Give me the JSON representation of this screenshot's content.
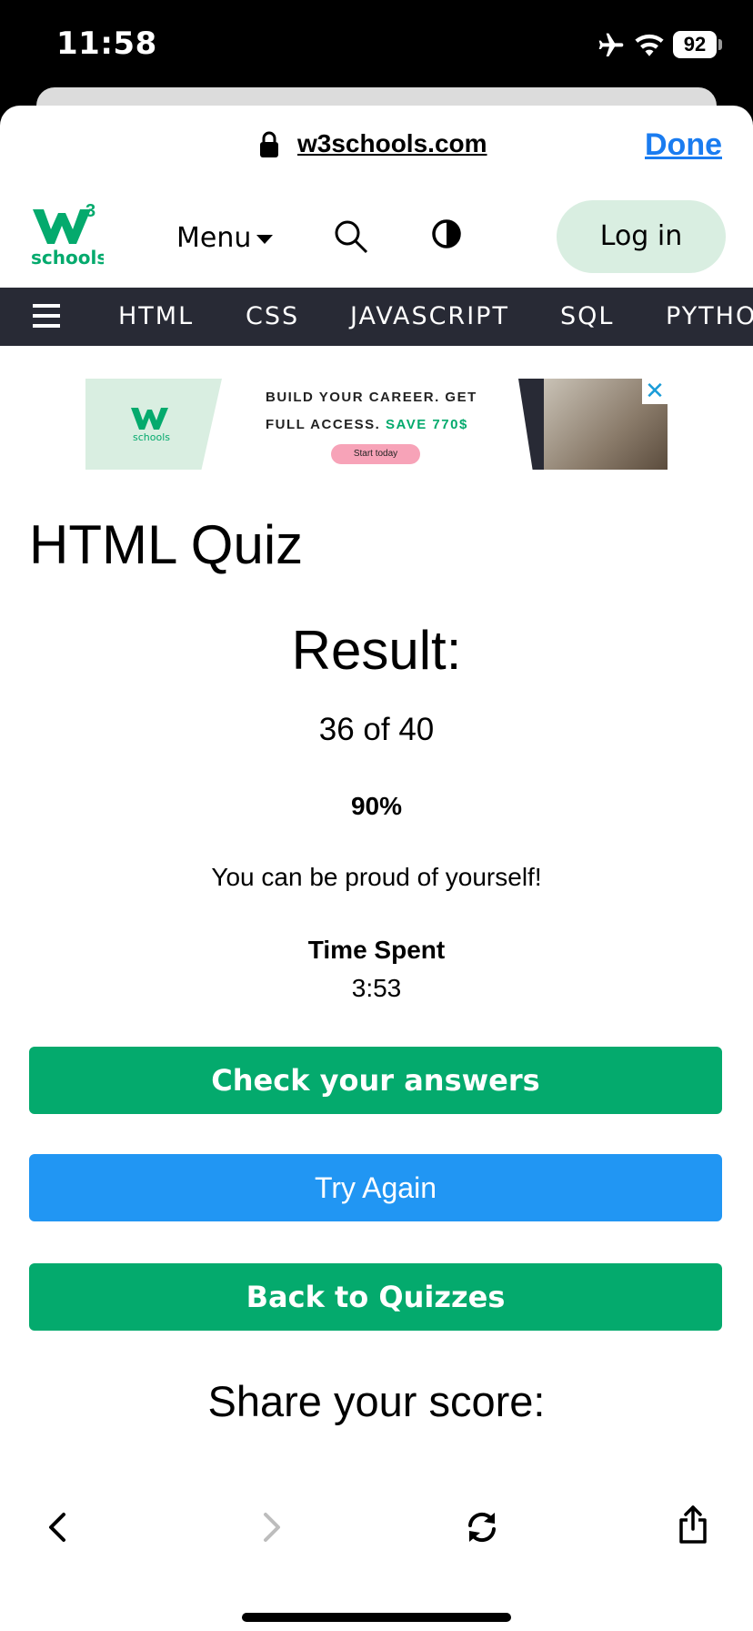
{
  "status_bar": {
    "time": "11:58",
    "battery": "92"
  },
  "browser": {
    "url": "w3schools.com",
    "done_label": "Done"
  },
  "topnav": {
    "logo_text": "schools",
    "logo_sup": "3",
    "menu_label": "Menu",
    "login_label": "Log in"
  },
  "subnav": {
    "items": [
      "HTML",
      "CSS",
      "JAVASCRIPT",
      "SQL",
      "PYTHO"
    ]
  },
  "ad": {
    "line1": "BUILD YOUR CAREER. GET",
    "line2_prefix": "FULL ACCESS.",
    "line2_save": "SAVE 770$",
    "button": "Start today",
    "logo_text": "schools",
    "close": "✕"
  },
  "quiz": {
    "title": "HTML Quiz",
    "result_heading": "Result:",
    "score": "36 of 40",
    "percent": "90%",
    "message": "You can be proud of yourself!",
    "time_spent_label": "Time Spent",
    "time_spent_value": "3:53",
    "check_button": "Check your answers",
    "try_again_button": "Try Again",
    "back_button": "Back to Quizzes",
    "share_heading": "Share your score:"
  },
  "colors": {
    "brand_green": "#04aa6d",
    "blue": "#2196f3",
    "dark_nav": "#282a35",
    "link_blue": "#1a7cf0"
  },
  "toolbar": {
    "icons": [
      "back-icon",
      "forward-icon",
      "reload-icon",
      "share-icon"
    ]
  }
}
